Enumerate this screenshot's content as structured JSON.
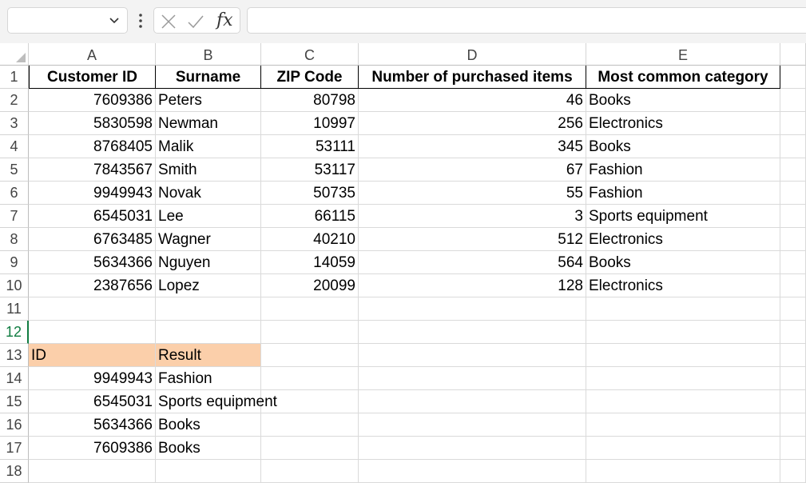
{
  "formula_bar": {
    "name_box": "",
    "fx_label": "fx",
    "formula": ""
  },
  "columns": [
    "A",
    "B",
    "C",
    "D",
    "E"
  ],
  "rows": [
    "1",
    "2",
    "3",
    "4",
    "5",
    "6",
    "7",
    "8",
    "9",
    "10",
    "11",
    "12",
    "13",
    "14",
    "15",
    "16",
    "17",
    "18"
  ],
  "active_row": "12",
  "table": {
    "headers": [
      "Customer ID",
      "Surname",
      "ZIP Code",
      "Number of purchased items",
      "Most common category"
    ],
    "rows": [
      [
        "7609386",
        "Peters",
        "80798",
        "46",
        "Books"
      ],
      [
        "5830598",
        "Newman",
        "10997",
        "256",
        "Electronics"
      ],
      [
        "8768405",
        "Malik",
        "53111",
        "345",
        "Books"
      ],
      [
        "7843567",
        "Smith",
        "53117",
        "67",
        "Fashion"
      ],
      [
        "9949943",
        "Novak",
        "50735",
        "55",
        "Fashion"
      ],
      [
        "6545031",
        "Lee",
        "66115",
        "3",
        "Sports equipment"
      ],
      [
        "6763485",
        "Wagner",
        "40210",
        "512",
        "Electronics"
      ],
      [
        "5634366",
        "Nguyen",
        "14059",
        "564",
        "Books"
      ],
      [
        "2387656",
        "Lopez",
        "20099",
        "128",
        "Electronics"
      ]
    ]
  },
  "lookup": {
    "header_id": "ID",
    "header_result": "Result",
    "header_color": "#fbcfaa",
    "rows": [
      [
        "9949943",
        "Fashion"
      ],
      [
        "6545031",
        "Sports equipment"
      ],
      [
        "5634366",
        "Books"
      ],
      [
        "7609386",
        "Books"
      ]
    ]
  }
}
